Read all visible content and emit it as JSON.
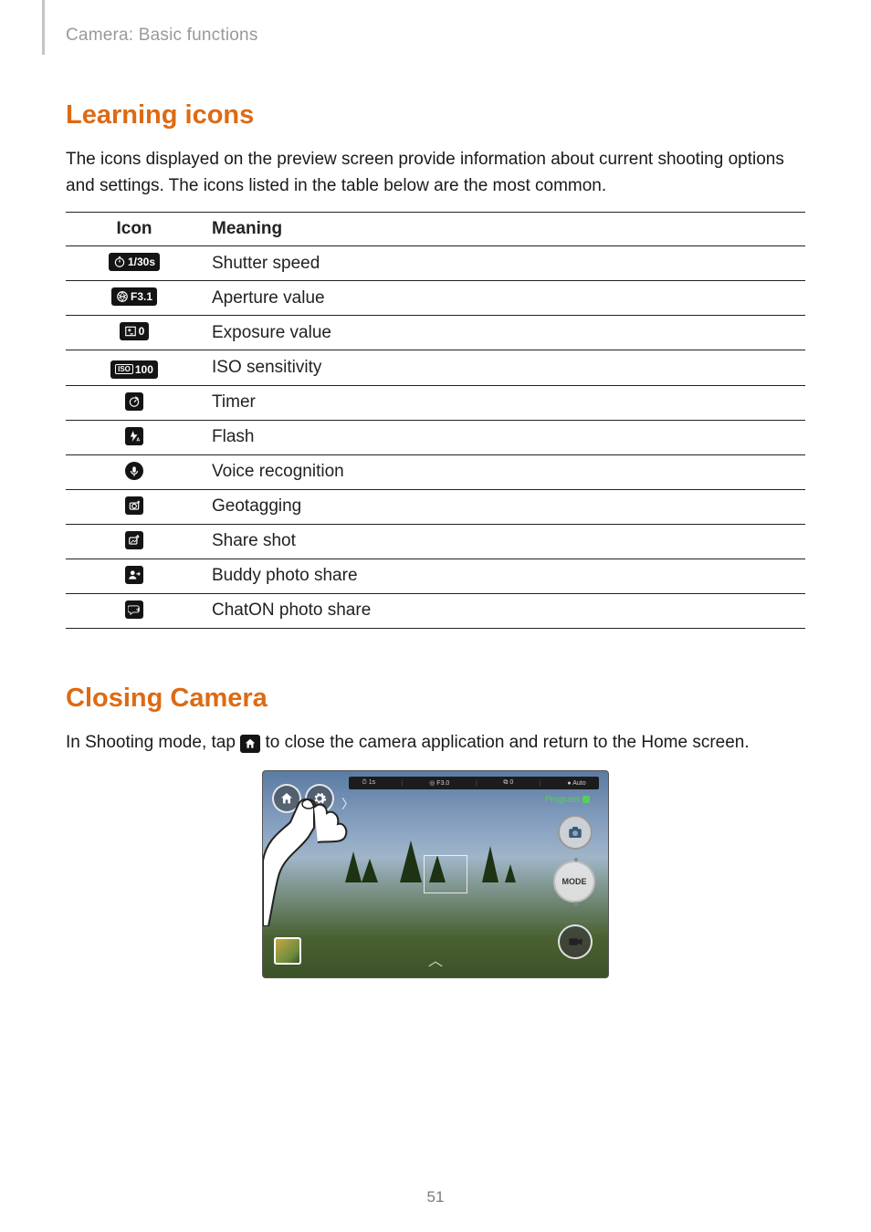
{
  "breadcrumb": "Camera: Basic functions",
  "section1": {
    "title": "Learning icons",
    "body": "The icons displayed on the preview screen provide information about current shooting options and settings. The icons listed in the table below are the most common."
  },
  "table": {
    "header_icon": "Icon",
    "header_meaning": "Meaning",
    "rows": [
      {
        "icon_label": "shutter-speed-icon",
        "icon_text": "1/30s",
        "meaning": "Shutter speed"
      },
      {
        "icon_label": "aperture-value-icon",
        "icon_text": "F3.1",
        "meaning": "Aperture value"
      },
      {
        "icon_label": "exposure-value-icon",
        "icon_text": "0",
        "meaning": "Exposure value"
      },
      {
        "icon_label": "iso-sensitivity-icon",
        "icon_text": "100",
        "meaning": "ISO sensitivity"
      },
      {
        "icon_label": "timer-icon",
        "icon_text": "",
        "meaning": "Timer"
      },
      {
        "icon_label": "flash-icon",
        "icon_text": "",
        "meaning": "Flash"
      },
      {
        "icon_label": "voice-recognition-icon",
        "icon_text": "",
        "meaning": "Voice recognition"
      },
      {
        "icon_label": "geotagging-icon",
        "icon_text": "",
        "meaning": "Geotagging"
      },
      {
        "icon_label": "share-shot-icon",
        "icon_text": "",
        "meaning": "Share shot"
      },
      {
        "icon_label": "buddy-photo-share-icon",
        "icon_text": "",
        "meaning": "Buddy photo share"
      },
      {
        "icon_label": "chaton-photo-share-icon",
        "icon_text": "",
        "meaning": "ChatON photo share"
      }
    ]
  },
  "section2": {
    "title": "Closing Camera",
    "body_before": "In Shooting mode, tap ",
    "body_after": " to close the camera application and return to the Home screen."
  },
  "preview": {
    "topbar": {
      "shutter": "1s",
      "aperture": "F3.0",
      "ev": "0",
      "iso": "Auto"
    },
    "mode_badge": "Program",
    "mode_button": "MODE"
  },
  "page_number": "51"
}
